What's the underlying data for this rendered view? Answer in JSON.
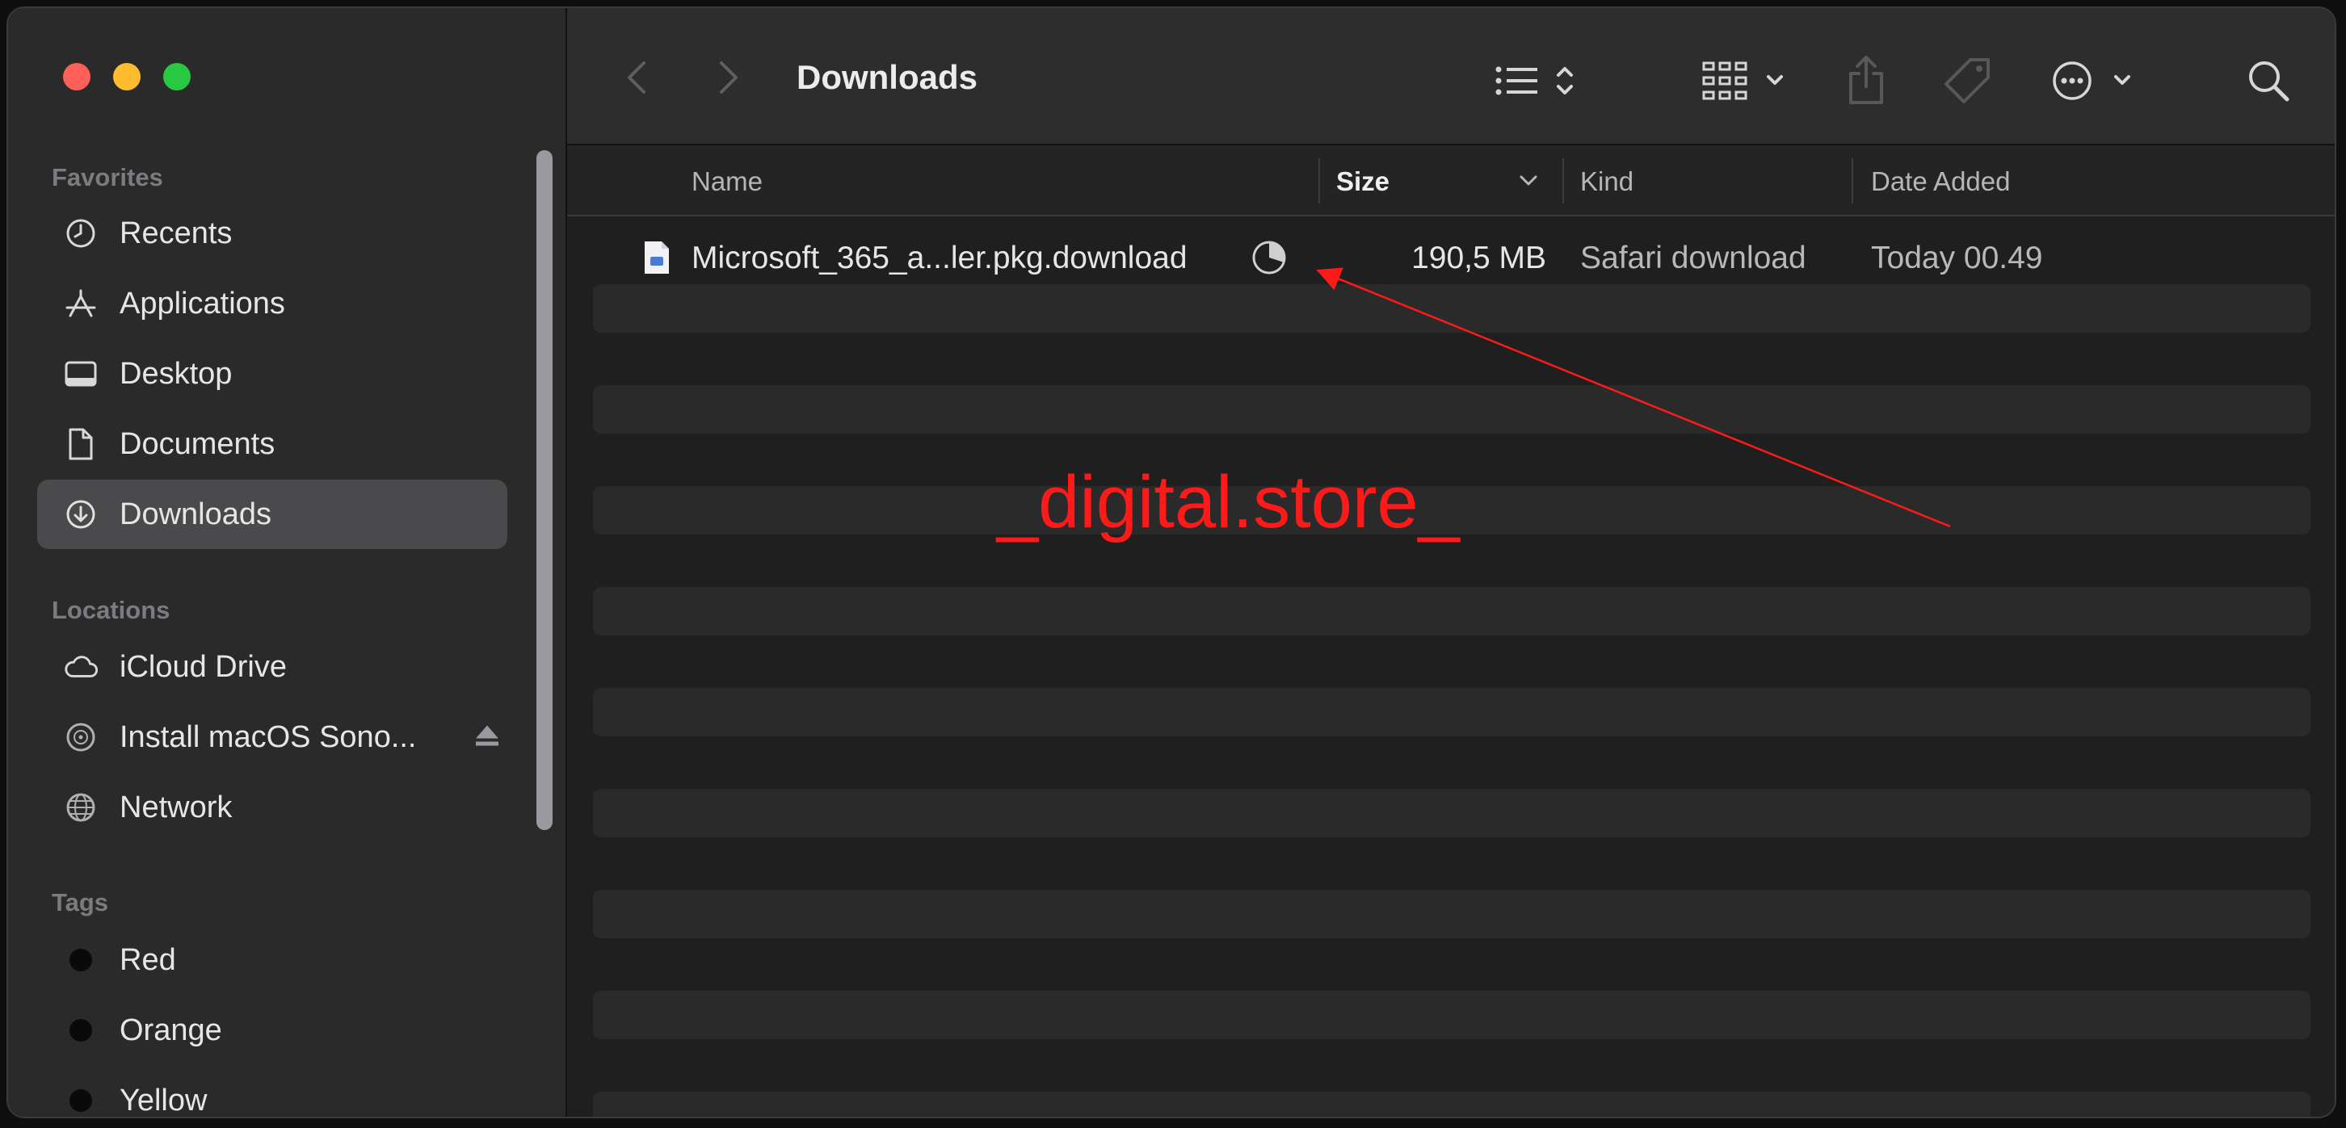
{
  "window": {
    "title": "Downloads"
  },
  "sidebar": {
    "favorites_header": "Favorites",
    "favorites": [
      {
        "label": "Recents",
        "icon": "clock-icon"
      },
      {
        "label": "Applications",
        "icon": "applications-icon"
      },
      {
        "label": "Desktop",
        "icon": "desktop-icon"
      },
      {
        "label": "Documents",
        "icon": "document-icon"
      },
      {
        "label": "Downloads",
        "icon": "download-icon",
        "selected": true
      }
    ],
    "locations_header": "Locations",
    "locations": [
      {
        "label": "iCloud Drive",
        "icon": "cloud-icon"
      },
      {
        "label": "Install macOS Sono...",
        "icon": "disk-icon",
        "eject": true
      },
      {
        "label": "Network",
        "icon": "globe-icon"
      }
    ],
    "tags_header": "Tags",
    "tags": [
      {
        "label": "Red"
      },
      {
        "label": "Orange"
      },
      {
        "label": "Yellow"
      }
    ]
  },
  "toolbar": {
    "title": "Downloads",
    "buttons": [
      "back-icon",
      "forward-icon",
      "list-view-icon",
      "group-icon",
      "share-icon",
      "tag-icon",
      "more-icon",
      "search-icon"
    ]
  },
  "columns": {
    "name": "Name",
    "size": "Size",
    "kind": "Kind",
    "date_added": "Date Added"
  },
  "files": [
    {
      "name": "Microsoft_365_a...ler.pkg.download",
      "size": "190,5 MB",
      "kind": "Safari download",
      "date_added": "Today 00.49",
      "progress_fraction": 0.3
    }
  ],
  "overlay": {
    "watermark": "_digital.store_",
    "color": "#ff1a1a"
  }
}
